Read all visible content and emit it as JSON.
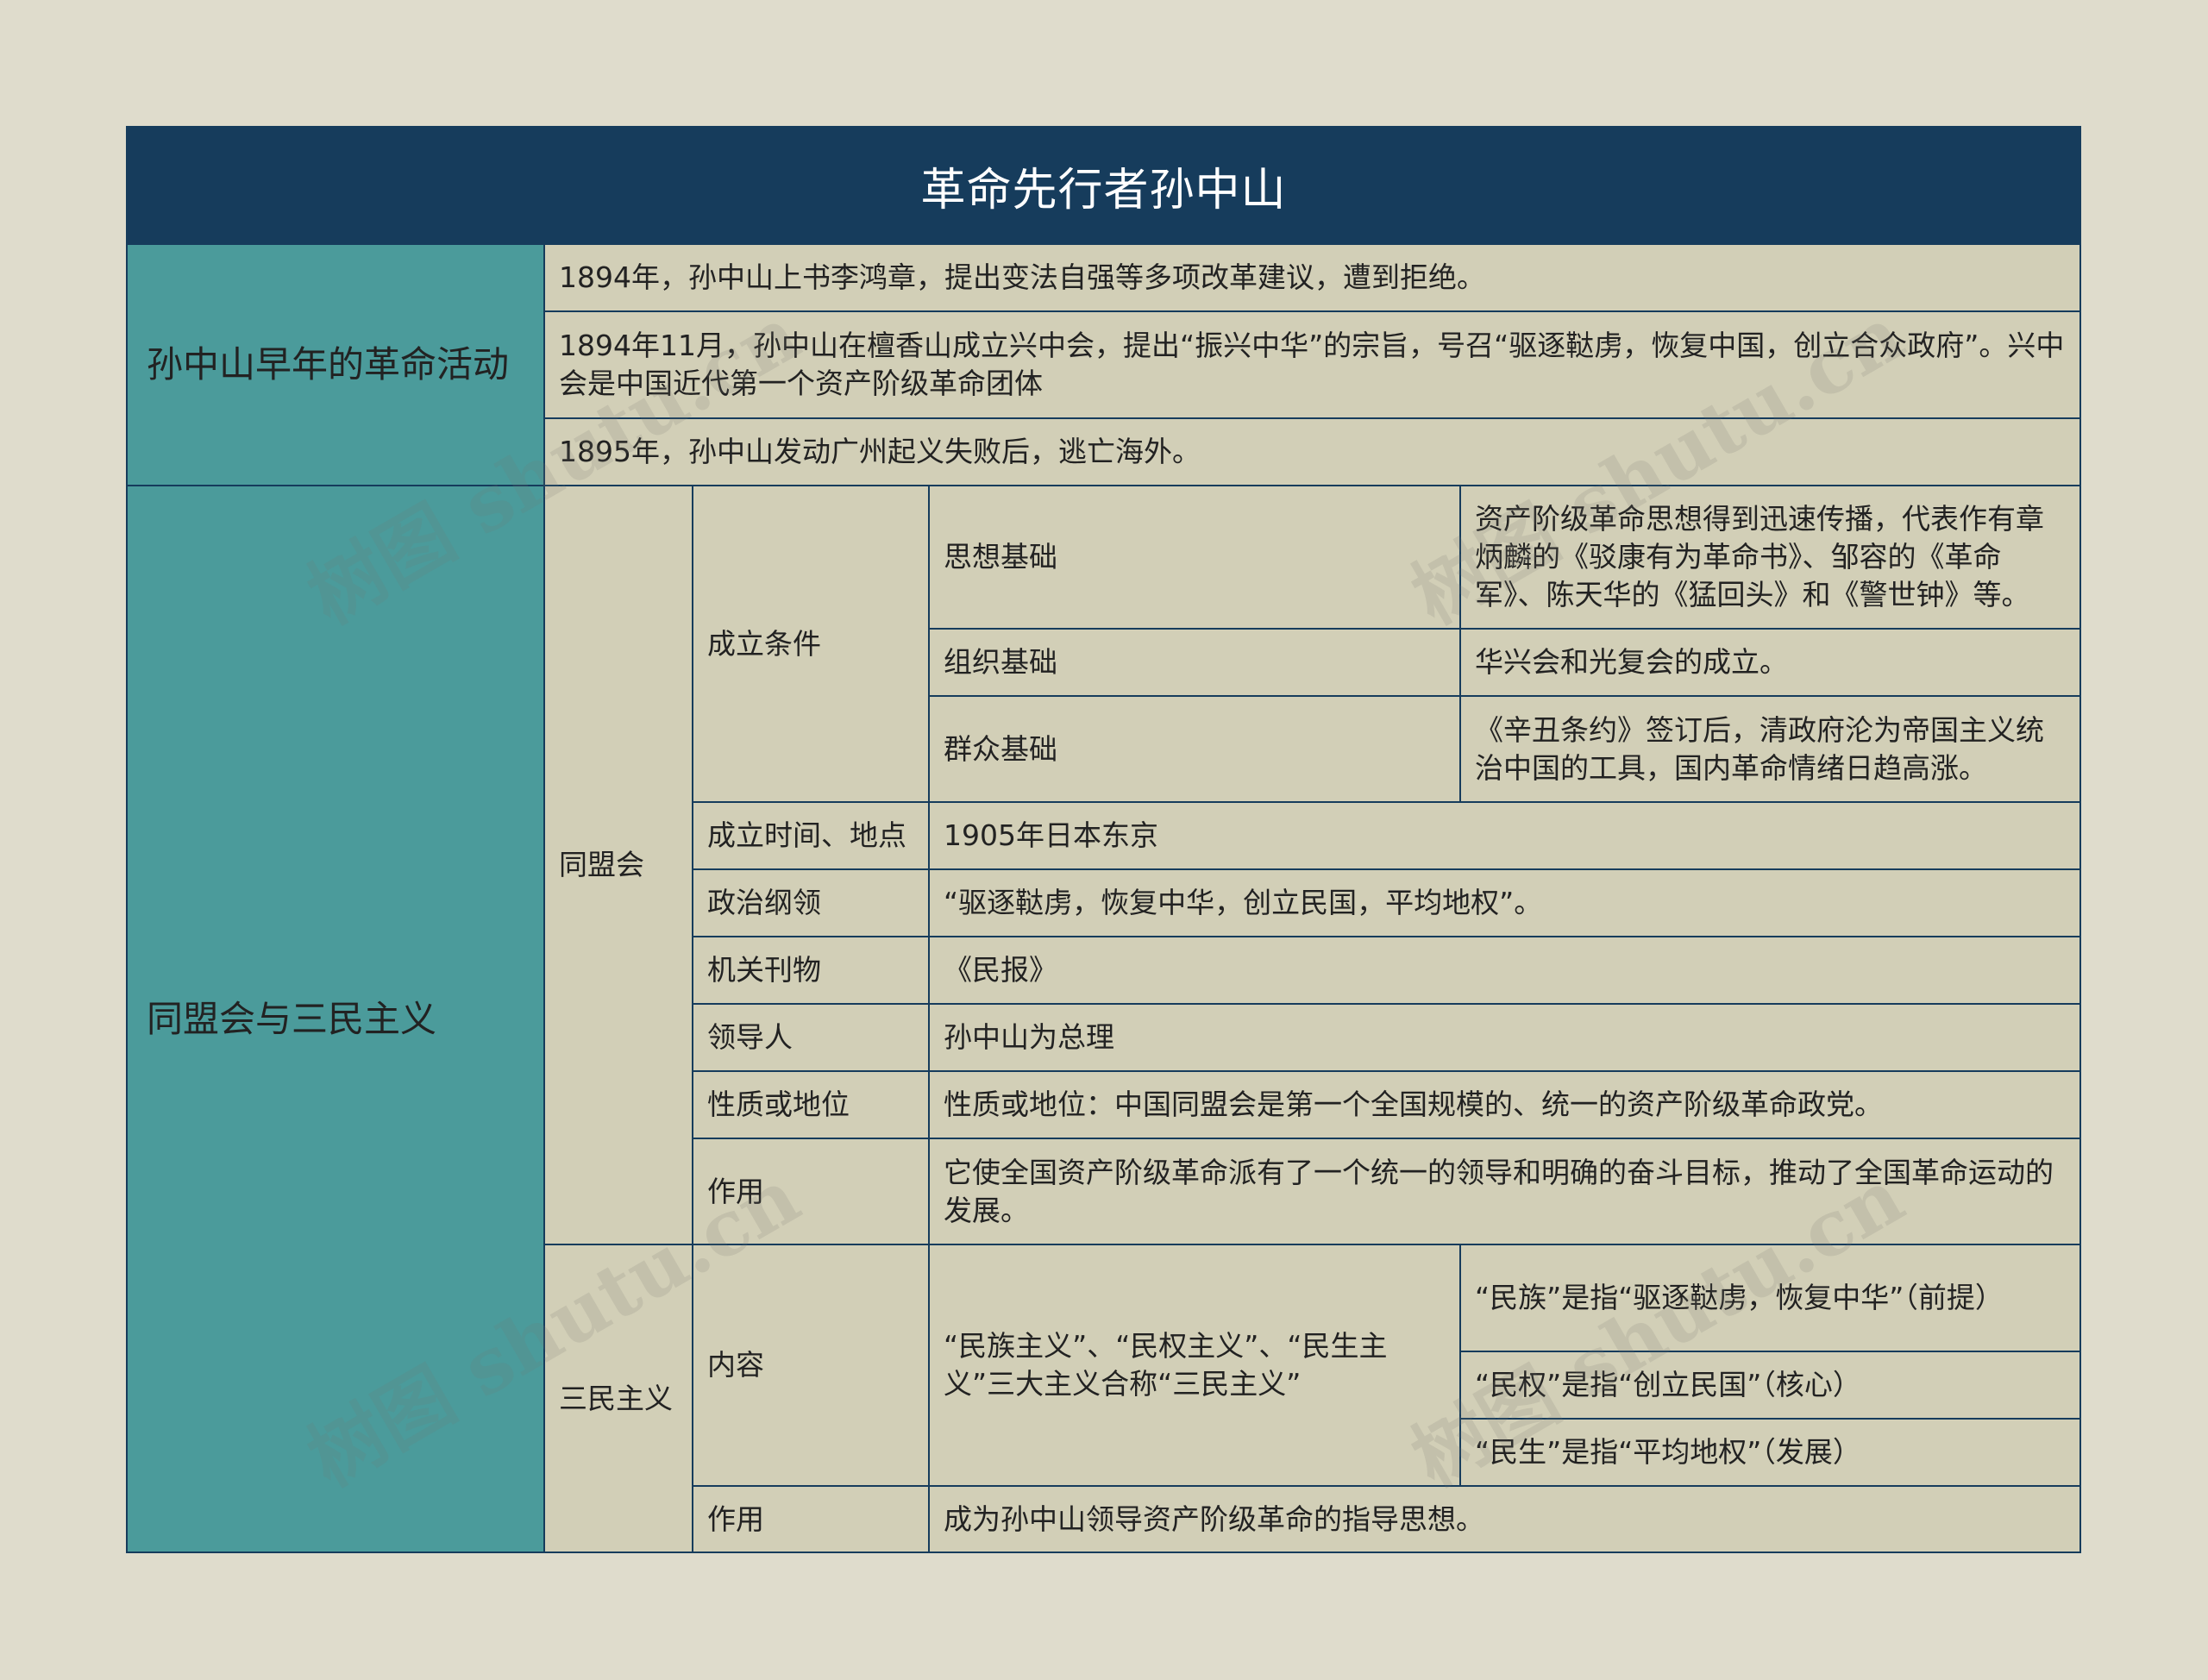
{
  "title": "革命先行者孙中山",
  "section1": {
    "label": "孙中山早年的革命活动",
    "items": [
      "1894年，孙中山上书李鸿章，提出变法自强等多项改革建议，遭到拒绝。",
      "1894年11月，孙中山在檀香山成立兴中会，提出“振兴中华”的宗旨，号召“驱逐鞑虏，恢复中国，创立合众政府”。兴中会是中国近代第一个资产阶级革命团体",
      "1895年，孙中山发动广州起义失败后，逃亡海外。"
    ]
  },
  "section2": {
    "label": "同盟会与三民主义",
    "tongmenghui": {
      "label": "同盟会",
      "conditions": {
        "label": "成立条件",
        "rows": [
          {
            "name": "思想基础",
            "desc": "资产阶级革命思想得到迅速传播，代表作有章炳麟的《驳康有为革命书》、邹容的《革命军》、陈天华的《猛回头》和《警世钟》等。"
          },
          {
            "name": "组织基础",
            "desc": "华兴会和光复会的成立。"
          },
          {
            "name": "群众基础",
            "desc": "《辛丑条约》签订后，清政府沦为帝国主义统治中国的工具，国内革命情绪日趋高涨。"
          }
        ]
      },
      "rows": [
        {
          "name": "成立时间、地点",
          "desc": "1905年日本东京"
        },
        {
          "name": "政治纲领",
          "desc": "“驱逐鞑虏，恢复中华，创立民国，平均地权”。"
        },
        {
          "name": "机关刊物",
          "desc": "《民报》"
        },
        {
          "name": "领导人",
          "desc": "孙中山为总理"
        },
        {
          "name": "性质或地位",
          "desc": "性质或地位：中国同盟会是第一个全国规模的、统一的资产阶级革命政党。"
        },
        {
          "name": "作用",
          "desc": "它使全国资产阶级革命派有了一个统一的领导和明确的奋斗目标，推动了全国革命运动的发展。"
        }
      ]
    },
    "sanmin": {
      "label": "三民主义",
      "content": {
        "label": "内容",
        "summary": "“民族主义”、“民权主义”、“民生主义”三大主义合称“三民主义”",
        "items": [
          "“民族”是指“驱逐鞑虏，恢复中华”（前提）",
          "“民权”是指“创立民国”（核心）",
          "“民生”是指“平均地权”（发展）"
        ]
      },
      "effect": {
        "name": "作用",
        "desc": "成为孙中山领导资产阶级革命的指导思想。"
      }
    }
  },
  "watermark": "树图 shutu.cn"
}
